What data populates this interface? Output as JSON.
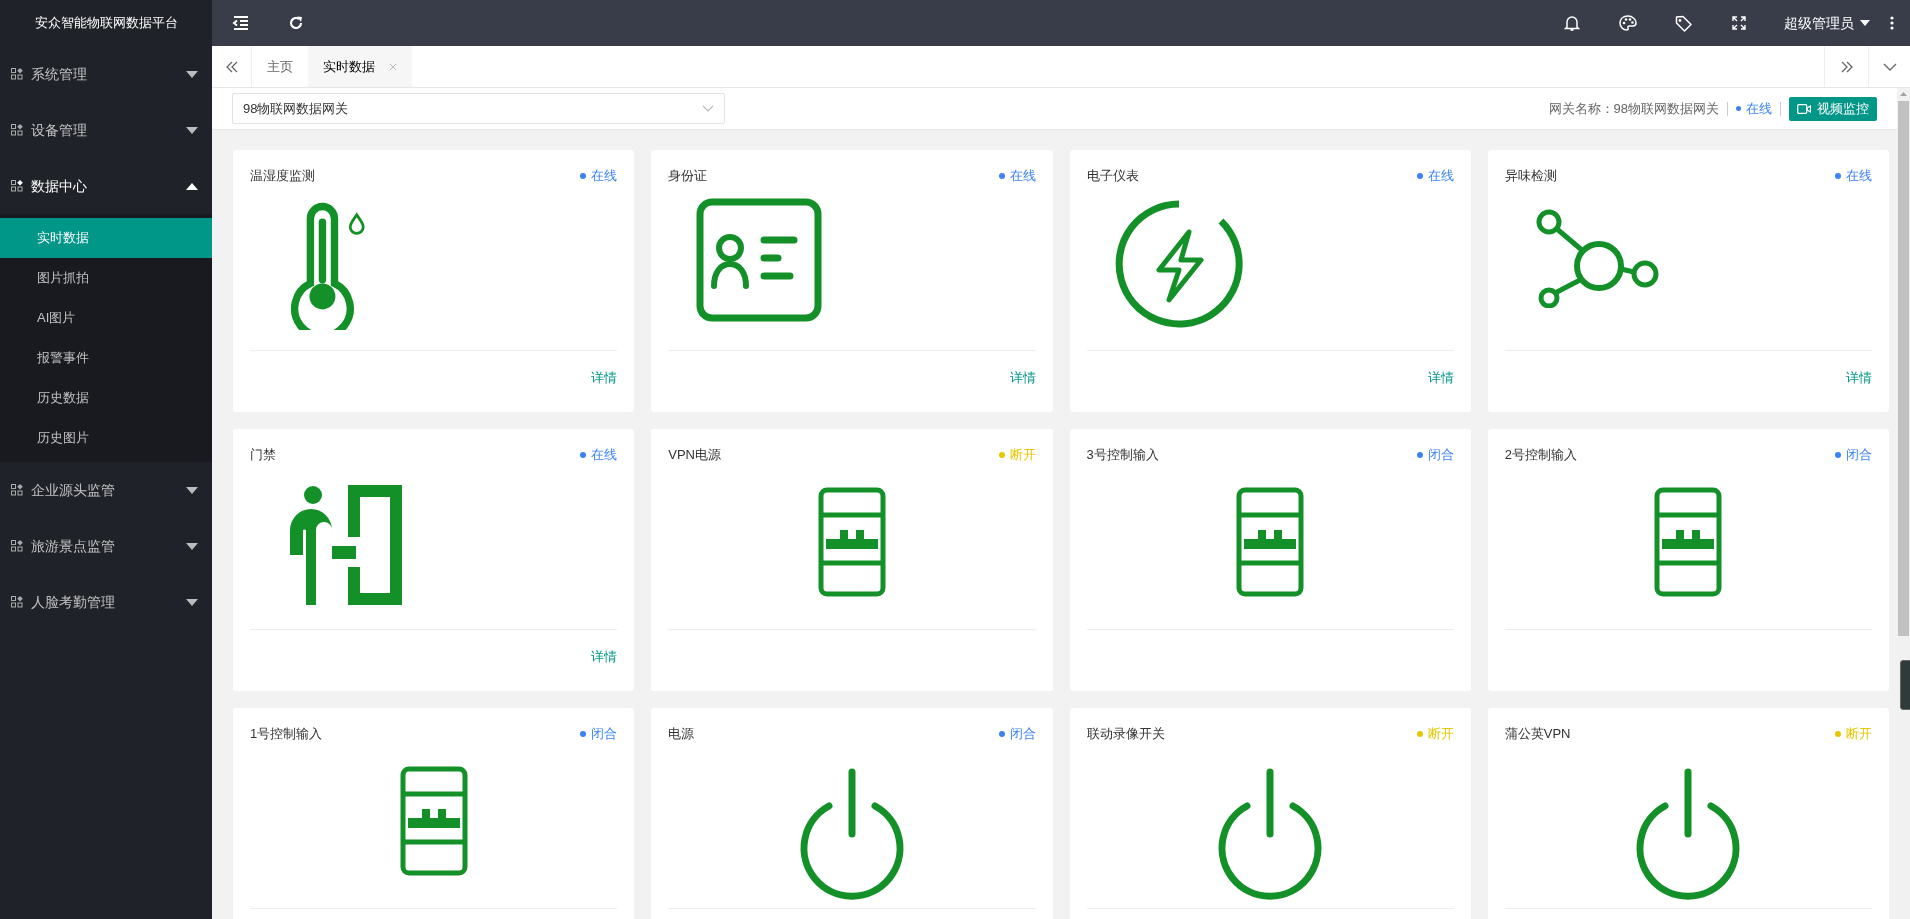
{
  "app": {
    "title": "安众智能物联网数据平台"
  },
  "topbar": {
    "user": "超级管理员"
  },
  "sidebar": {
    "items": [
      {
        "label": "系统管理",
        "expanded": false
      },
      {
        "label": "设备管理",
        "expanded": false
      },
      {
        "label": "数据中心",
        "expanded": true,
        "children": [
          {
            "label": "实时数据",
            "selected": true
          },
          {
            "label": "图片抓拍",
            "selected": false
          },
          {
            "label": "AI图片",
            "selected": false
          },
          {
            "label": "报警事件",
            "selected": false
          },
          {
            "label": "历史数据",
            "selected": false
          },
          {
            "label": "历史图片",
            "selected": false
          }
        ]
      },
      {
        "label": "企业源头监管",
        "expanded": false
      },
      {
        "label": "旅游景点监管",
        "expanded": false
      },
      {
        "label": "人脸考勤管理",
        "expanded": false
      }
    ]
  },
  "tabs": [
    {
      "label": "主页",
      "selected": false,
      "closable": false
    },
    {
      "label": "实时数据",
      "selected": true,
      "closable": true
    }
  ],
  "gateway_select": {
    "value": "98物联网数据网关"
  },
  "gateway_info": {
    "label": "网关名称：98物联网数据网关",
    "status": "在线"
  },
  "video_button": {
    "label": "视频监控"
  },
  "cards": [
    {
      "title": "温湿度监测",
      "status": "在线",
      "color": "#3b82f6",
      "kind": "thermometer",
      "detail": "详情"
    },
    {
      "title": "身份证",
      "status": "在线",
      "color": "#3b82f6",
      "kind": "idcard",
      "detail": "详情"
    },
    {
      "title": "电子仪表",
      "status": "在线",
      "color": "#3b82f6",
      "kind": "meter",
      "detail": "详情"
    },
    {
      "title": "异味检测",
      "status": "在线",
      "color": "#3b82f6",
      "kind": "molecule",
      "detail": "详情"
    },
    {
      "title": "门禁",
      "status": "在线",
      "color": "#3b82f6",
      "kind": "door",
      "detail": "详情"
    },
    {
      "title": "VPN电源",
      "status": "断开",
      "color": "#e6c600",
      "kind": "switch"
    },
    {
      "title": "3号控制输入",
      "status": "闭合",
      "color": "#3b82f6",
      "kind": "switch"
    },
    {
      "title": "2号控制输入",
      "status": "闭合",
      "color": "#3b82f6",
      "kind": "switch"
    },
    {
      "title": "1号控制输入",
      "status": "闭合",
      "color": "#3b82f6",
      "kind": "switch"
    },
    {
      "title": "电源",
      "status": "闭合",
      "color": "#3b82f6",
      "kind": "power"
    },
    {
      "title": "联动录像开关",
      "status": "断开",
      "color": "#e6c600",
      "kind": "power"
    },
    {
      "title": "蒲公英VPN",
      "status": "断开",
      "color": "#e6c600",
      "kind": "power"
    }
  ]
}
